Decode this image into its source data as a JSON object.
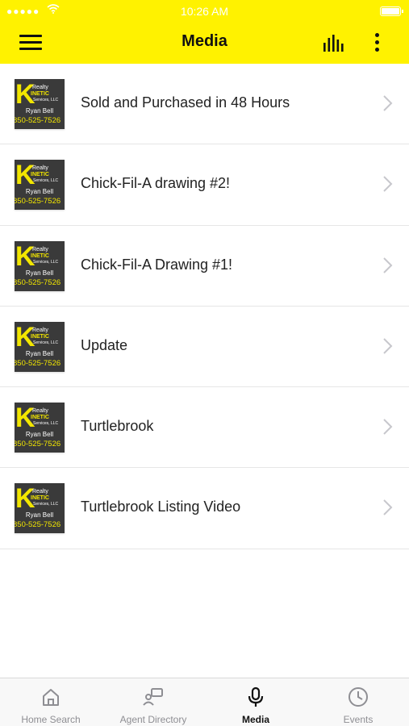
{
  "status_bar": {
    "time": "10:26 AM",
    "signal": "●●●●●"
  },
  "header": {
    "title": "Media",
    "background_color": "#fff200"
  },
  "thumbnail": {
    "realty": "Realty",
    "letter": "K",
    "brand": "INETIC",
    "services": "Services, LLC",
    "agent": "Ryan Bell",
    "phone": "850-525-7526"
  },
  "media_items": [
    {
      "title": "Sold and Purchased in 48 Hours"
    },
    {
      "title": "Chick-Fil-A drawing #2!"
    },
    {
      "title": "Chick-Fil-A Drawing #1!"
    },
    {
      "title": "Update"
    },
    {
      "title": "Turtlebrook"
    },
    {
      "title": "Turtlebrook Listing Video"
    }
  ],
  "tabs": [
    {
      "label": "Home Search",
      "icon": "home-icon",
      "active": false
    },
    {
      "label": "Agent Directory",
      "icon": "agent-directory-icon",
      "active": false
    },
    {
      "label": "Media",
      "icon": "microphone-icon",
      "active": true
    },
    {
      "label": "Events",
      "icon": "clock-icon",
      "active": false
    }
  ]
}
